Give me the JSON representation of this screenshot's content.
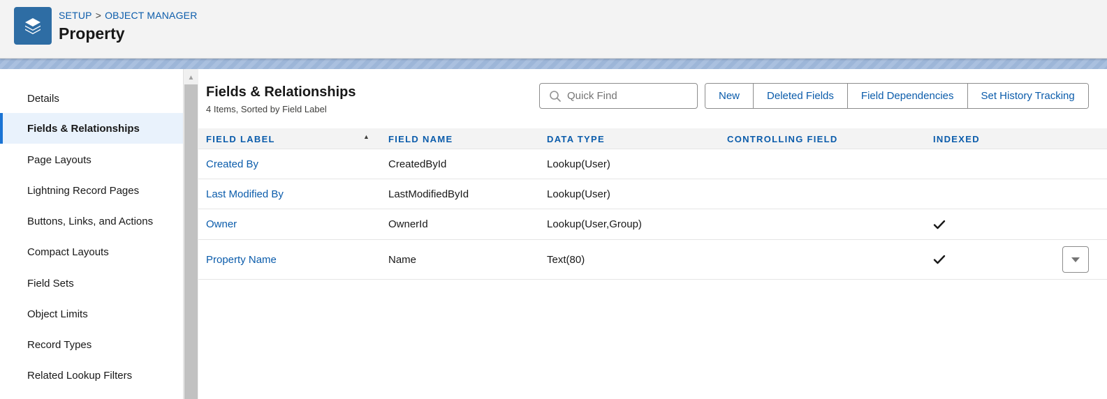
{
  "header": {
    "breadcrumb": [
      "SETUP",
      "OBJECT MANAGER"
    ],
    "breadcrumb_separator": ">",
    "title": "Property",
    "app_icon": "layers-icon",
    "accent_color": "#2e6da4"
  },
  "sidebar": {
    "items": [
      {
        "label": "Details",
        "active": false
      },
      {
        "label": "Fields & Relationships",
        "active": true
      },
      {
        "label": "Page Layouts",
        "active": false
      },
      {
        "label": "Lightning Record Pages",
        "active": false
      },
      {
        "label": "Buttons, Links, and Actions",
        "active": false
      },
      {
        "label": "Compact Layouts",
        "active": false
      },
      {
        "label": "Field Sets",
        "active": false
      },
      {
        "label": "Object Limits",
        "active": false
      },
      {
        "label": "Record Types",
        "active": false
      },
      {
        "label": "Related Lookup Filters",
        "active": false
      }
    ]
  },
  "main": {
    "title": "Fields & Relationships",
    "subtitle": "4 Items, Sorted by Field Label",
    "search": {
      "placeholder": "Quick Find",
      "value": ""
    },
    "buttons": [
      "New",
      "Deleted Fields",
      "Field Dependencies",
      "Set History Tracking"
    ],
    "table": {
      "columns": [
        "FIELD LABEL",
        "FIELD NAME",
        "DATA TYPE",
        "CONTROLLING FIELD",
        "INDEXED"
      ],
      "sort_column": "FIELD LABEL",
      "sort_direction": "ascending",
      "rows": [
        {
          "field_label": "Created By",
          "field_name": "CreatedById",
          "data_type": "Lookup(User)",
          "controlling_field": "",
          "indexed": false
        },
        {
          "field_label": "Last Modified By",
          "field_name": "LastModifiedById",
          "data_type": "Lookup(User)",
          "controlling_field": "",
          "indexed": false
        },
        {
          "field_label": "Owner",
          "field_name": "OwnerId",
          "data_type": "Lookup(User,Group)",
          "controlling_field": "",
          "indexed": true
        },
        {
          "field_label": "Property Name",
          "field_name": "Name",
          "data_type": "Text(80)",
          "controlling_field": "",
          "indexed": true,
          "has_row_menu": true
        }
      ]
    }
  },
  "colors": {
    "link": "#0b5cab",
    "active_bg": "#e9f2fc",
    "active_border": "#1b74d4"
  }
}
